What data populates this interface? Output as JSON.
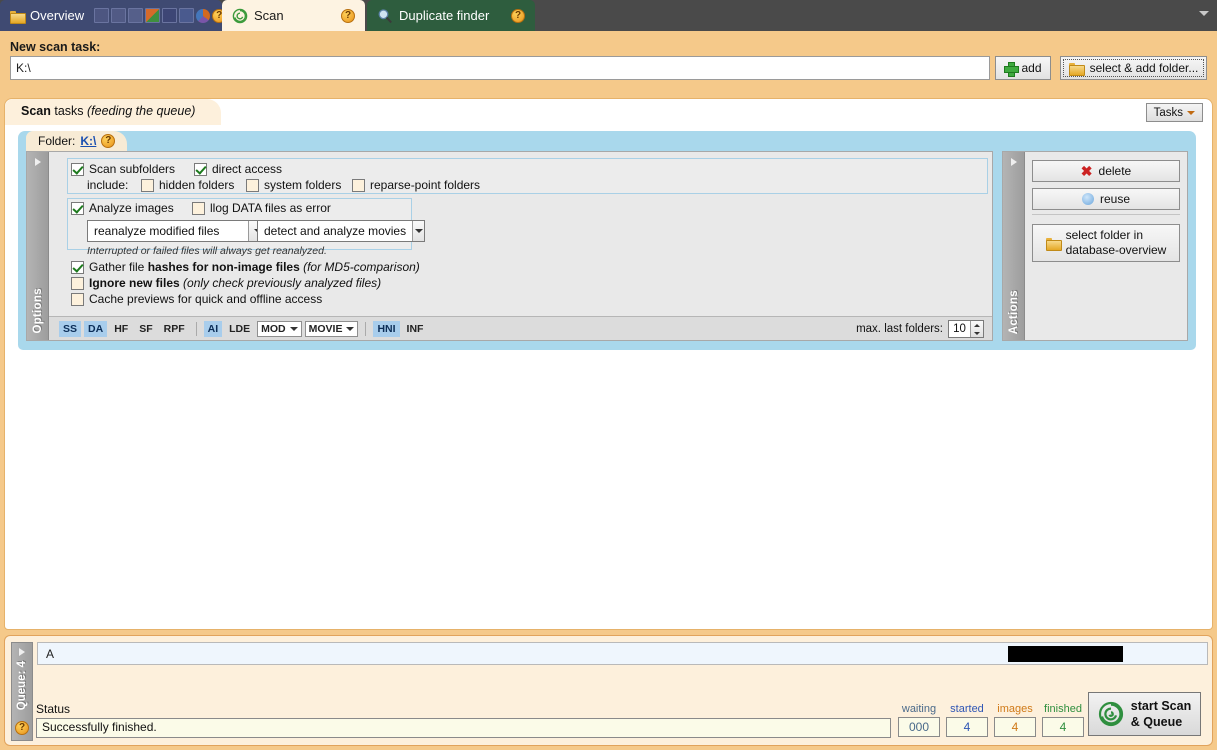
{
  "window": {
    "tabs": [
      {
        "label": "Overview",
        "icon": "folder-icon",
        "help": "?",
        "pin": "pin-icon"
      },
      {
        "label": "Scan",
        "icon": "spiral-icon",
        "help": "?"
      },
      {
        "label": "Duplicate finder",
        "icon": "magnifier-icon",
        "help": "?"
      }
    ],
    "menu_chevron": "chevron-down-icon"
  },
  "new_task": {
    "label": "New scan task:",
    "path_value": "K:\\",
    "add_label": "add",
    "select_add_label": "select & add folder..."
  },
  "scan_tasks": {
    "title_bold": "Scan",
    "title_rest": " tasks ",
    "title_italic": "(feeding the queue)",
    "tasks_button": "Tasks"
  },
  "folder_panel": {
    "prefix": "Folder:",
    "path": "K:\\",
    "help": "?"
  },
  "options": {
    "vertical_label": "Options",
    "scan_subfolders": {
      "label": "Scan subfolders",
      "checked": true
    },
    "direct_access": {
      "label": "direct access",
      "checked": true
    },
    "include_label": "include:",
    "hidden_folders": {
      "label": "hidden folders",
      "checked": false
    },
    "system_folders": {
      "label": "system folders",
      "checked": false
    },
    "reparse_point_folders": {
      "label": "reparse-point folders",
      "checked": false
    },
    "analyze_images": {
      "label": "Analyze images",
      "checked": true
    },
    "log_data_error": {
      "label": "llog DATA files as error",
      "checked": false
    },
    "reanalyze_combo": "reanalyze modified files",
    "movies_combo": "detect and analyze movies",
    "hint": "Interrupted or failed files will always get reanalyzed.",
    "gather_hashes": {
      "text_a": "Gather file ",
      "text_b": "hashes for ",
      "text_c": "non-image files ",
      "italic": "(for MD5-comparison)",
      "checked": true
    },
    "ignore_new": {
      "label": "Ignore new files ",
      "italic": "(only check previously analyzed files)",
      "checked": false
    },
    "cache_previews": {
      "label": "Cache previews for quick and offline access",
      "checked": false
    },
    "tags": [
      {
        "text": "SS",
        "highlight": true,
        "type": "tag"
      },
      {
        "text": "DA",
        "highlight": true,
        "type": "tag"
      },
      {
        "text": "HF",
        "highlight": false,
        "type": "tag"
      },
      {
        "text": "SF",
        "highlight": false,
        "type": "tag"
      },
      {
        "text": "RPF",
        "highlight": false,
        "type": "tag"
      },
      {
        "text": "|",
        "type": "sep"
      },
      {
        "text": "AI",
        "highlight": true,
        "type": "tag"
      },
      {
        "text": "LDE",
        "highlight": false,
        "type": "tag"
      },
      {
        "text": "MOD",
        "highlight": false,
        "type": "combo"
      },
      {
        "text": "MOVIE",
        "highlight": false,
        "type": "combo"
      },
      {
        "text": "|",
        "type": "sep"
      },
      {
        "text": "HNI",
        "highlight": true,
        "type": "tag"
      },
      {
        "text": "INF",
        "highlight": false,
        "type": "tag"
      }
    ],
    "max_last_folders_label": "max. last folders:",
    "max_last_folders_value": "10"
  },
  "actions": {
    "vertical_label": "Actions",
    "delete_label": "delete",
    "reuse_label": "reuse",
    "select_folder_line1": "select folder in",
    "select_folder_line2": "database-overview"
  },
  "queue": {
    "vertical_label": "Queue: 4",
    "help": "?",
    "row_text": "A",
    "status_label": "Status",
    "status_value": "Successfully finished.",
    "counters": [
      {
        "name": "waiting",
        "value": "000",
        "color": "#4a6a8a"
      },
      {
        "name": "started",
        "value": "4",
        "color": "#2f56b5"
      },
      {
        "name": "images",
        "value": "4",
        "color": "#d07a18"
      },
      {
        "name": "finished",
        "value": "4",
        "color": "#2f8f3f"
      }
    ],
    "start_line1": "start Scan",
    "start_line2": "& Queue"
  }
}
